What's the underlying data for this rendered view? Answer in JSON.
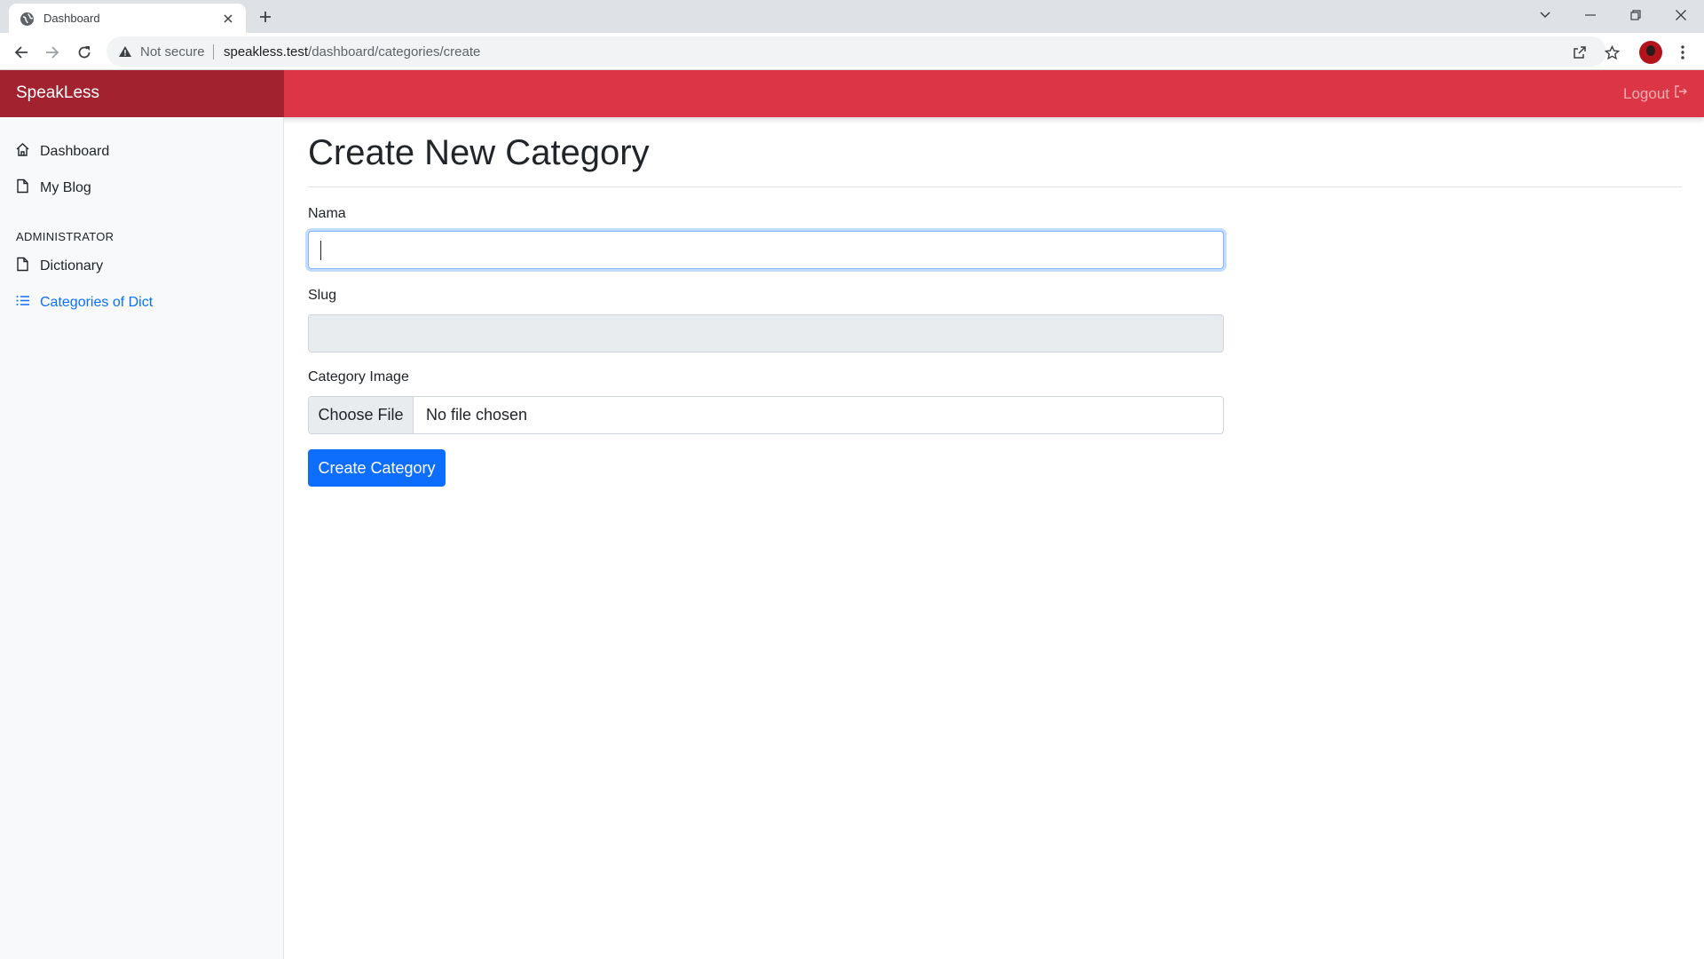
{
  "browser": {
    "tab_title": "Dashboard",
    "security_label": "Not secure",
    "url_host": "speakless.test",
    "url_path": "/dashboard/categories/create"
  },
  "app": {
    "brand": "SpeakLess",
    "logout_label": "Logout",
    "accent_color": "#dc3545",
    "brand_color": "#a3222f"
  },
  "sidebar": {
    "items": [
      {
        "label": "Dashboard",
        "icon": "house-icon"
      },
      {
        "label": "My Blog",
        "icon": "file-icon"
      }
    ],
    "admin_heading": "ADMINISTRATOR",
    "admin_items": [
      {
        "label": "Dictionary",
        "icon": "file-icon"
      },
      {
        "label": "Categories of Dict",
        "icon": "list-icon",
        "active": true
      }
    ]
  },
  "form": {
    "page_title": "Create New Category",
    "name_label": "Nama",
    "name_value": "",
    "slug_label": "Slug",
    "slug_value": "",
    "image_label": "Category Image",
    "file_button": "Choose File",
    "file_status": "No file chosen",
    "submit_label": "Create Category"
  }
}
